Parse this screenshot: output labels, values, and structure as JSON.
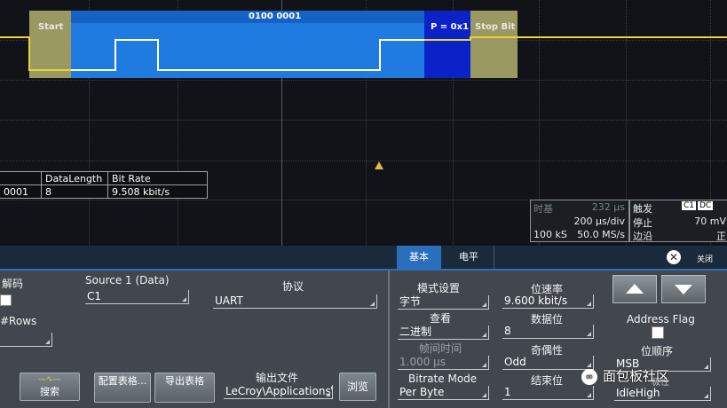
{
  "decode": {
    "byte_label": "0100 0001",
    "start_label": "Start",
    "parity_label": "P = 0x1",
    "stop_label": "Stop Bit"
  },
  "measure_table": {
    "headers": [
      "DataLength",
      "Bit Rate"
    ],
    "row": [
      "0001",
      "8",
      "9.508 kbit/s"
    ]
  },
  "timebase": {
    "time_label": "时基",
    "time_offset": "232 μs",
    "div": "200 μs/div",
    "points": "100 kS",
    "rate": "50.0 MS/s",
    "trigger_label": "触发",
    "trigger_channel": "C1",
    "trigger_coupling": "DC",
    "trigger_state": "停止",
    "trigger_level": "70 mV",
    "trigger_mode": "边沿",
    "trigger_slope": "正"
  },
  "tabs": {
    "basic": "基本",
    "level": "电平",
    "close": "关闭"
  },
  "left_panel": {
    "decode_label": "解码",
    "rows_label": "#Rows",
    "source_label": "Source 1 (Data)",
    "source_value": "C1",
    "protocol_label": "协议",
    "protocol_value": "UART",
    "search_button": "搜索",
    "config_table_button": "配置表格...",
    "export_table_button": "导出表格",
    "output_file_label": "输出文件",
    "output_file_value": "LeCroy\\Applications\\",
    "browse_button": "浏览"
  },
  "right_panel": {
    "mode_label": "模式设置",
    "mode_value": "字节",
    "view_label": "查看",
    "view_value": "二进制",
    "frame_time_label": "帧间时间",
    "frame_time_value": "1.000 μs",
    "bitrate_mode_label": "Bitrate Mode",
    "bitrate_mode_value": "Per Byte",
    "bitrate_label": "位速率",
    "bitrate_value": "9.600 kbit/s",
    "databits_label": "数据位",
    "databits_value": "8",
    "parity_label": "奇偶性",
    "parity_value": "Odd",
    "stopbits_label": "结束位",
    "stopbits_value": "1",
    "address_flag_label": "Address Flag",
    "bit_order_label": "位顺序",
    "bit_order_value": "MSB",
    "polarity_label": "极性",
    "polarity_value": "IdleHigh"
  },
  "watermark": "面包板社区",
  "colors": {
    "waveform": "#e8d33a",
    "decode_blue": "#1f7be0",
    "parity_blue": "#0a22c8",
    "frame_tan": "#a8a86a",
    "tab_blue": "#2a6fbe"
  }
}
